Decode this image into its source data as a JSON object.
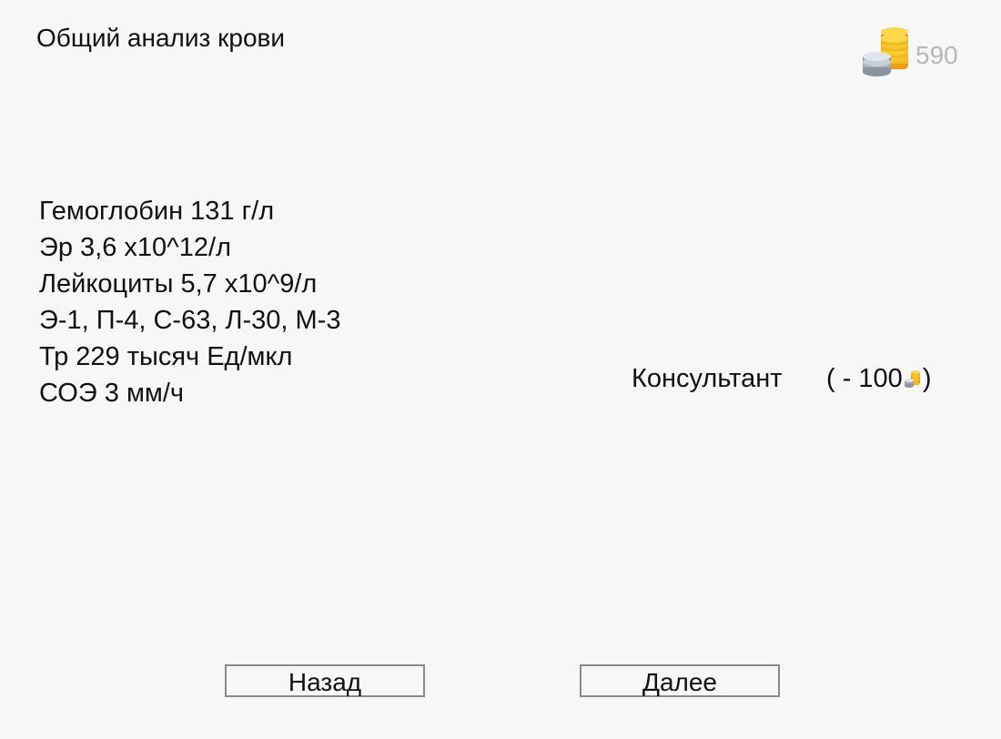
{
  "header": {
    "title": "Общий анализ крови"
  },
  "balance": {
    "icon": "coins-stack-icon",
    "value": "590"
  },
  "blood_test": {
    "lines": [
      "Гемоглобин 131 г/л",
      "Эр 3,6 х10^12/л",
      "Лейкоциты 5,7 х10^9/л",
      "Э-1, П-4, С-63, Л-30, М-3",
      "Тр 229 тысяч Ед/мкл",
      "СОЭ 3 мм/ч"
    ]
  },
  "consultant": {
    "label": "Консультант",
    "cost_prefix": "( - 100",
    "cost_suffix": ")",
    "icon": "coins-icon"
  },
  "navigation": {
    "back_label": "Назад",
    "next_label": "Далее"
  },
  "colors": {
    "background": "#f7f7f7",
    "text": "#111111",
    "balance_text": "#b7b7b7",
    "button_border": "#8a8a8a",
    "coin_gold": "#f2b81f",
    "coin_silver": "#aab3bb"
  }
}
